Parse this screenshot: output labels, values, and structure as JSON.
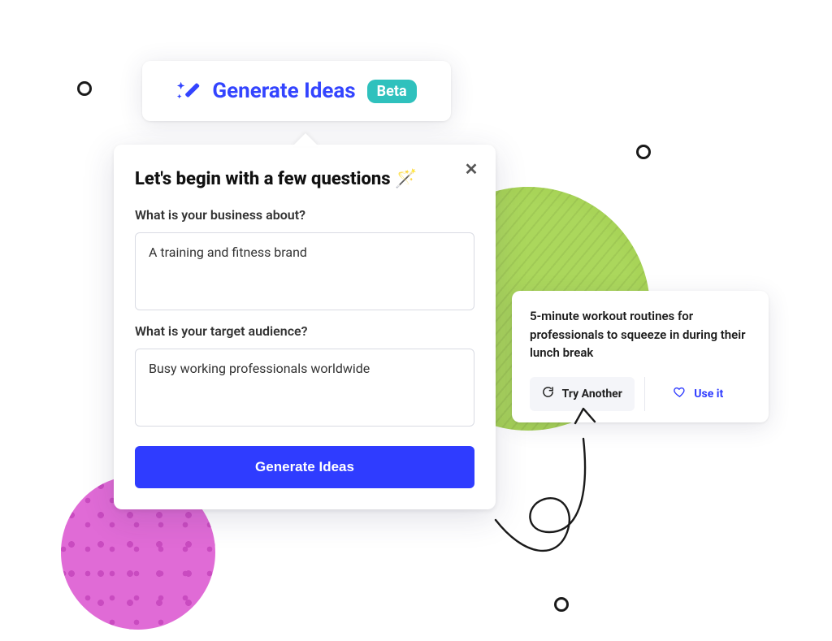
{
  "colors": {
    "brand": "#2f3cff",
    "beta_bg": "#2fc1bd",
    "green_blob": "#a7cf5f",
    "pink_blob": "#e06bd6"
  },
  "header": {
    "title": "Generate Ideas",
    "badge": "Beta",
    "icon": "magic-wand-icon"
  },
  "popover": {
    "title": "Let's begin with a few questions 🪄",
    "close_label": "✕",
    "q1_label": "What is your business about?",
    "q1_value": "A training and fitness brand",
    "q2_label": "What is your target audience?",
    "q2_value": "Busy working professionals worldwide",
    "submit_label": "Generate Ideas"
  },
  "idea_card": {
    "text": "5-minute workout routines for professionals to squeeze in during their lunch break",
    "try_another_label": "Try Another",
    "use_it_label": "Use it"
  }
}
